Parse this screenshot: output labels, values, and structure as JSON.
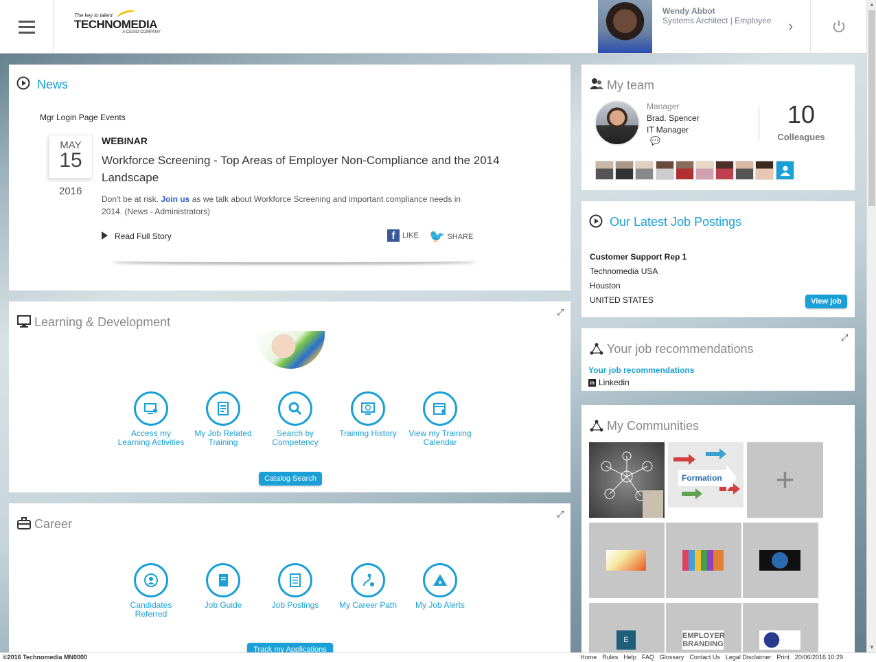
{
  "header": {
    "logo_tagline": "The key to talent",
    "logo_name": "TECHNOMEDIA",
    "logo_sub": "A CESIO COMPANY",
    "user_name": "Wendy Abbot",
    "user_role": "Systems Architect | Employee"
  },
  "news": {
    "title": "News",
    "section_label": "Mgr Login Page Events",
    "month": "MAY",
    "day": "15",
    "year": "2016",
    "type": "WEBINAR",
    "headline": "Workforce Screening - Top Areas of Employer Non-Compliance and the 2014 Landscape",
    "body_before": "Don't be at risk.",
    "body_link": "Join us",
    "body_after": "as we talk about Workforce Screening and important compliance needs in 2014. (News - Administrators)",
    "read_full": "Read Full Story",
    "like": "LIKE",
    "share": "SHARE"
  },
  "learning": {
    "title": "Learning & Development",
    "items": [
      {
        "label": "Access my Learning Activities",
        "icon": "learning-activities-icon"
      },
      {
        "label": "My Job Related Training",
        "icon": "job-training-icon"
      },
      {
        "label": "Search by Competency",
        "icon": "search-icon"
      },
      {
        "label": "Training History",
        "icon": "training-history-icon"
      },
      {
        "label": "View my Training Calendar",
        "icon": "calendar-icon"
      }
    ],
    "catalog_button": "Catalog Search"
  },
  "career": {
    "title": "Career",
    "items": [
      {
        "label": "Candidates Referred",
        "icon": "candidates-icon"
      },
      {
        "label": "Job Guide",
        "icon": "book-icon"
      },
      {
        "label": "Job Postings",
        "icon": "document-icon"
      },
      {
        "label": "My Career Path",
        "icon": "career-path-icon"
      },
      {
        "label": "My Job Alerts",
        "icon": "alert-icon"
      }
    ],
    "track_button": "Track my Applications"
  },
  "team": {
    "title": "My team",
    "manager_label": "Manager",
    "manager_name": "Brad. Spencer",
    "manager_title": "IT Manager",
    "count": "10",
    "count_label": "Colleagues"
  },
  "jobs": {
    "title": "Our Latest Job Postings",
    "job_title": "Customer Support Rep 1",
    "company": "Technomedia USA",
    "city": "Houston",
    "country": "UNITED STATES",
    "view_button": "View job"
  },
  "reco": {
    "title": "Your job recommendations",
    "link": "Your job recommendations",
    "source": "Linkedin"
  },
  "communities": {
    "title": "My Communities",
    "formation_label": "Formation",
    "tile_e": "E",
    "tile_employer": "EMPLOYER BRANDING"
  },
  "footer": {
    "copyright": "©2016 Technomedia MN0000",
    "links": [
      "Home",
      "Rules",
      "Help",
      "FAQ",
      "Glossary",
      "Contact Us",
      "Legal Disclaimer",
      "Print",
      "20/06/2016  10:29"
    ]
  },
  "colors": {
    "accent": "#1aa0d6"
  }
}
